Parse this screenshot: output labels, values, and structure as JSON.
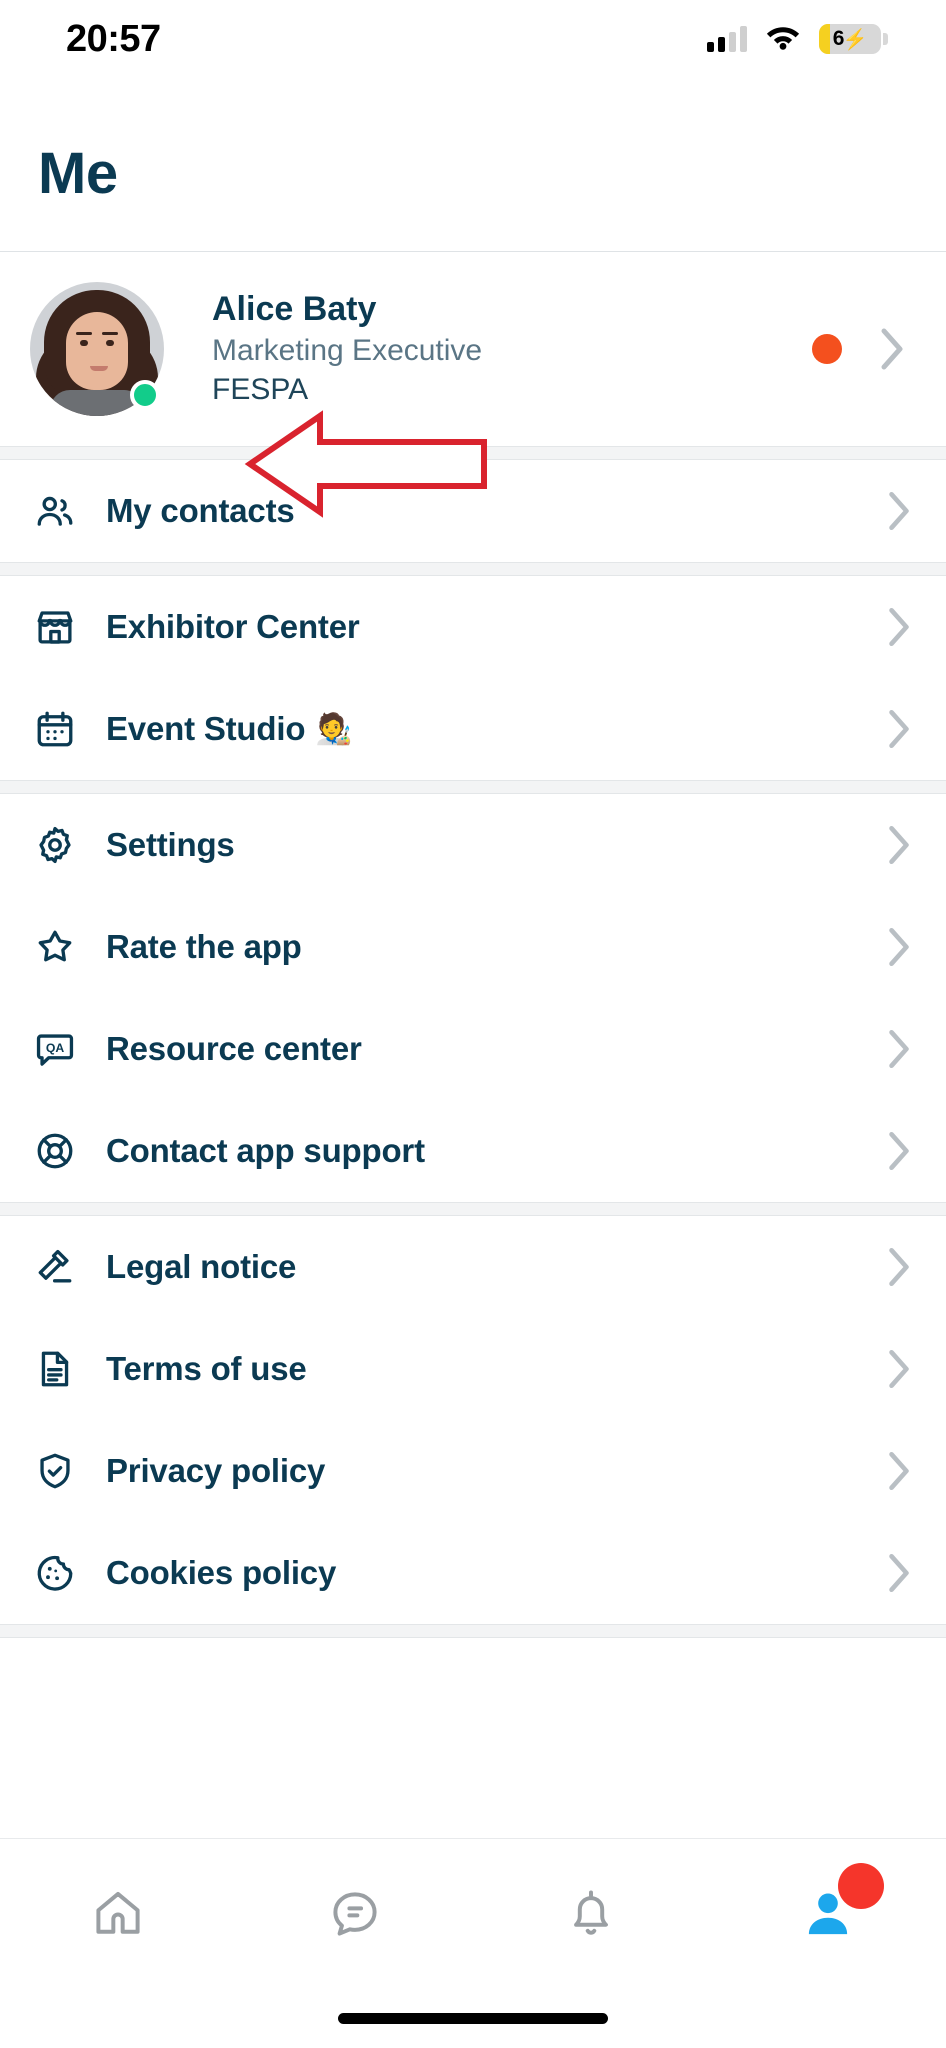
{
  "status_bar": {
    "time": "20:57",
    "battery_level": "6",
    "battery_charging_glyph": "⚡",
    "signal_bars_total": 4,
    "signal_bars_filled": 2,
    "wifi": "wifi-icon",
    "battery_fill_color": "#f5d020"
  },
  "header": {
    "title": "Me",
    "title_color": "#0b3a52"
  },
  "profile": {
    "name": "Alice Baty",
    "role": "Marketing Executive",
    "company": "FESPA",
    "online_status_color": "#12cc8a",
    "notification_dot_color": "#f4501e",
    "chevron": "›",
    "avatar": "user-avatar-photo"
  },
  "annotation": {
    "type": "arrow",
    "color": "#d9232e",
    "points_to": "My contacts"
  },
  "menu_groups": [
    {
      "items": [
        {
          "label": "My contacts",
          "icon": "contacts-icon",
          "emoji": ""
        }
      ]
    },
    {
      "items": [
        {
          "label": "Exhibitor Center",
          "icon": "storefront-icon",
          "emoji": ""
        },
        {
          "label": "Event Studio",
          "icon": "calendar-icon",
          "emoji": "🧑‍🎨"
        }
      ]
    },
    {
      "items": [
        {
          "label": "Settings",
          "icon": "gear-icon",
          "emoji": ""
        },
        {
          "label": "Rate the app",
          "icon": "star-icon",
          "emoji": ""
        },
        {
          "label": "Resource center",
          "icon": "qa-bubble-icon",
          "emoji": ""
        },
        {
          "label": "Contact app support",
          "icon": "lifebuoy-icon",
          "emoji": ""
        }
      ]
    },
    {
      "items": [
        {
          "label": "Legal notice",
          "icon": "gavel-icon",
          "emoji": ""
        },
        {
          "label": "Terms of use",
          "icon": "document-icon",
          "emoji": ""
        },
        {
          "label": "Privacy policy",
          "icon": "shield-check-icon",
          "emoji": ""
        },
        {
          "label": "Cookies policy",
          "icon": "cookie-icon",
          "emoji": ""
        }
      ]
    }
  ],
  "tab_bar": {
    "items": [
      {
        "name": "home",
        "icon": "home-icon",
        "active": false
      },
      {
        "name": "messages",
        "icon": "chat-bubble-icon",
        "active": false
      },
      {
        "name": "notifications",
        "icon": "bell-icon",
        "active": false
      },
      {
        "name": "profile",
        "icon": "person-icon",
        "active": true,
        "badge": true
      }
    ],
    "active_color": "#1ca7ec",
    "inactive_color": "#9a9fa3",
    "badge_color": "#f5352b"
  }
}
